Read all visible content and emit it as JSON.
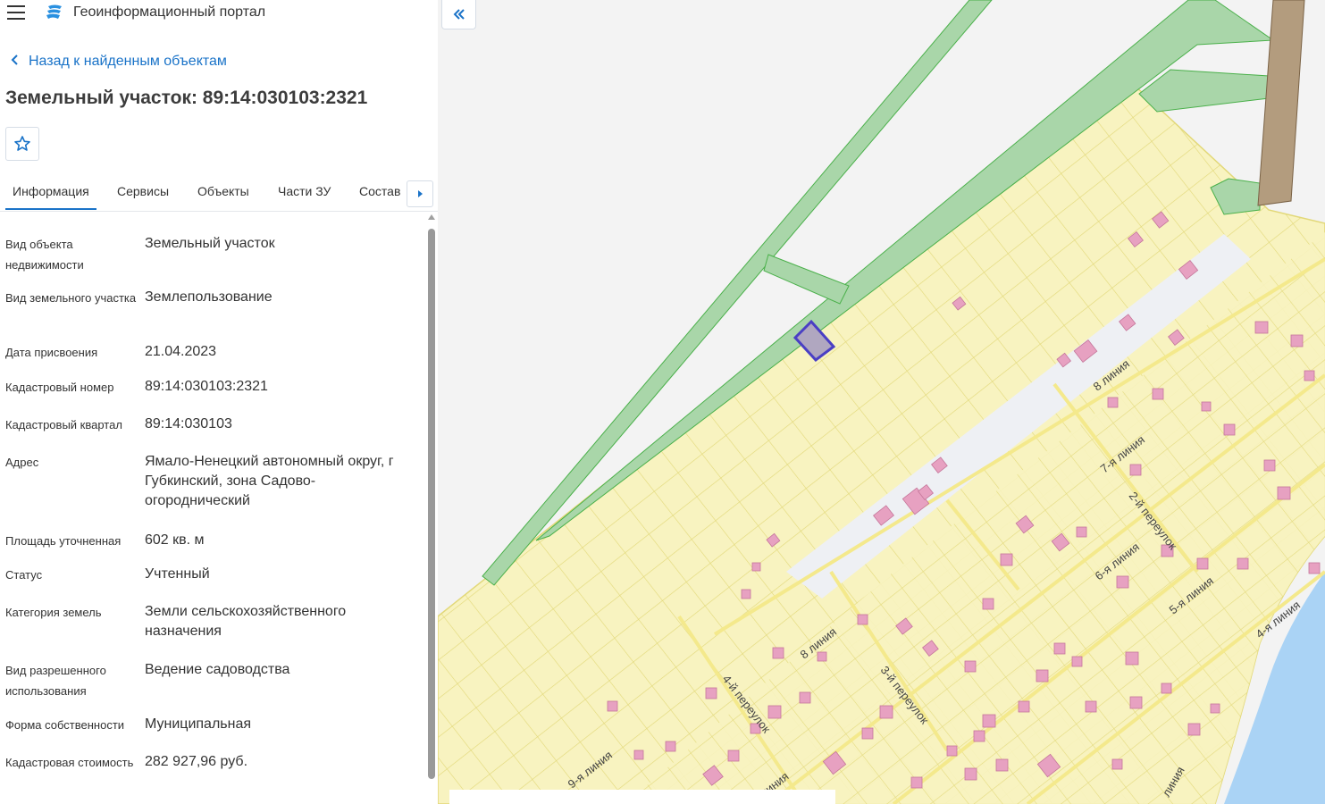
{
  "header": {
    "title": "Геоинформационный портал"
  },
  "nav": {
    "back_label": "Назад к найденным объектам"
  },
  "page": {
    "title": "Земельный участок: 89:14:030103:2321"
  },
  "tabs": [
    {
      "label": "Информация"
    },
    {
      "label": "Сервисы"
    },
    {
      "label": "Объекты"
    },
    {
      "label": "Части ЗУ"
    },
    {
      "label": "Состав"
    }
  ],
  "properties": [
    {
      "label": "Вид объекта недвижимости",
      "value": "Земельный участок"
    },
    {
      "label": "Вид земельного участка",
      "value": "Землепользование"
    },
    {
      "label": "Дата присвоения",
      "value": "21.04.2023"
    },
    {
      "label": "Кадастровый номер",
      "value": "89:14:030103:2321"
    },
    {
      "label": "Кадастровый квартал",
      "value": "89:14:030103"
    },
    {
      "label": "Адрес",
      "value": "Ямало-Ненецкий автономный округ, г Губкинский, зона Садово-огороднический"
    },
    {
      "label": "Площадь уточненная",
      "value": "602 кв. м"
    },
    {
      "label": "Статус",
      "value": "Учтенный"
    },
    {
      "label": "Категория земель",
      "value": "Земли сельскохозяйственного назначения"
    },
    {
      "label": "Вид разрешенного использования",
      "value": "Ведение садоводства"
    },
    {
      "label": "Форма собственности",
      "value": "Муниципальная"
    },
    {
      "label": "Кадастровая стоимость",
      "value": "282 927,96 руб."
    }
  ],
  "map": {
    "streets": [
      "8 линия",
      "7-я линия",
      "2-й переулок",
      "6-я линия",
      "5-я линия",
      "4-я линия",
      "8 линия",
      "3-й переулок",
      "4-й переулок",
      "9-я линия",
      "линия",
      "линия"
    ]
  },
  "colors": {
    "accent": "#1a73c8",
    "parcel_fill": "#f8f3c0",
    "parcel_stroke": "#e2d878",
    "green_zone": "#a9d6a9",
    "building": "#e7a1c1",
    "selected": "#4a3fc4",
    "water": "#aad3f5"
  }
}
